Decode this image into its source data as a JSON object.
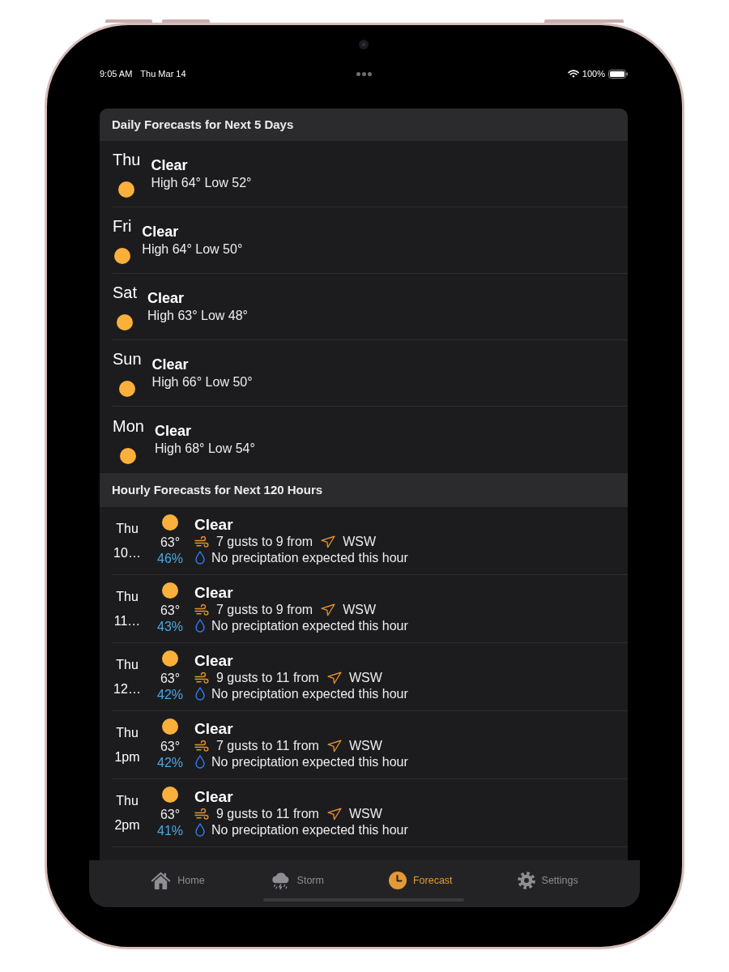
{
  "status_bar": {
    "time": "9:05 AM",
    "date": "Thu Mar 14",
    "battery": "100%"
  },
  "daily": {
    "title": "Daily Forecasts for Next 5 Days",
    "days": [
      {
        "day": "Thu",
        "condition": "Clear",
        "temps": "High 64° Low 52°"
      },
      {
        "day": "Fri",
        "condition": "Clear",
        "temps": "High 64° Low 50°"
      },
      {
        "day": "Sat",
        "condition": "Clear",
        "temps": "High 63° Low 48°"
      },
      {
        "day": "Sun",
        "condition": "Clear",
        "temps": "High 66° Low 50°"
      },
      {
        "day": "Mon",
        "condition": "Clear",
        "temps": "High 68° Low 54°"
      }
    ]
  },
  "hourly": {
    "title": "Hourly Forecasts for Next 120 Hours",
    "hours": [
      {
        "day": "Thu",
        "time": "10…",
        "temp": "63°",
        "humidity": "46%",
        "condition": "Clear",
        "wind": "7 gusts to 9 from",
        "direction": "WSW",
        "precipitation": "No preciptation expected this hour"
      },
      {
        "day": "Thu",
        "time": "11…",
        "temp": "63°",
        "humidity": "43%",
        "condition": "Clear",
        "wind": "7 gusts to 9 from",
        "direction": "WSW",
        "precipitation": "No preciptation expected this hour"
      },
      {
        "day": "Thu",
        "time": "12…",
        "temp": "63°",
        "humidity": "42%",
        "condition": "Clear",
        "wind": "9 gusts to 11 from",
        "direction": "WSW",
        "precipitation": "No preciptation expected this hour"
      },
      {
        "day": "Thu",
        "time": "1pm",
        "temp": "63°",
        "humidity": "42%",
        "condition": "Clear",
        "wind": "7 gusts to 11 from",
        "direction": "WSW",
        "precipitation": "No preciptation expected this hour"
      },
      {
        "day": "Thu",
        "time": "2pm",
        "temp": "63°",
        "humidity": "41%",
        "condition": "Clear",
        "wind": "9 gusts to 11 from",
        "direction": "WSW",
        "precipitation": "No preciptation expected this hour"
      }
    ]
  },
  "tab_bar": {
    "tabs": [
      {
        "label": "Home",
        "selected": false
      },
      {
        "label": "Storm",
        "selected": false
      },
      {
        "label": "Forecast",
        "selected": true
      },
      {
        "label": "Settings",
        "selected": false
      }
    ]
  }
}
